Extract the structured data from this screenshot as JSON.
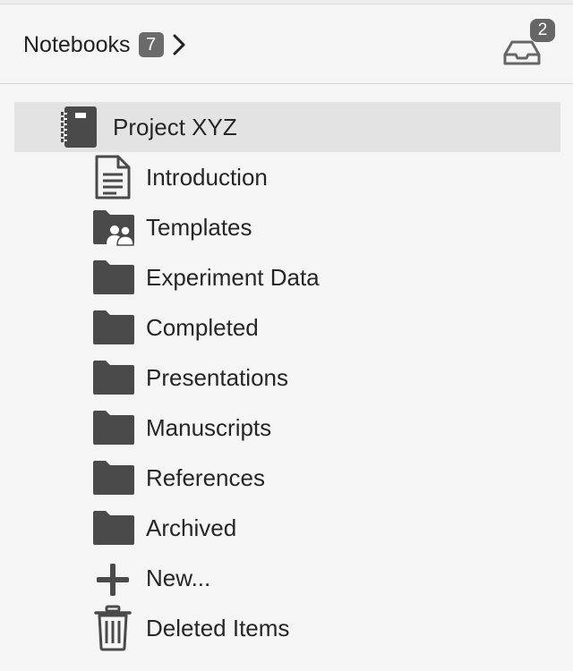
{
  "header": {
    "notebooks_label": "Notebooks",
    "notebooks_count": "7",
    "inbox_count": "2"
  },
  "tree": {
    "notebook": {
      "label": "Project XYZ",
      "icon": "notebook-icon",
      "selected": true
    },
    "items": [
      {
        "label": "Introduction",
        "icon": "document-icon"
      },
      {
        "label": "Templates",
        "icon": "shared-folder-icon"
      },
      {
        "label": "Experiment Data",
        "icon": "folder-icon"
      },
      {
        "label": "Completed",
        "icon": "folder-icon"
      },
      {
        "label": "Presentations",
        "icon": "folder-icon"
      },
      {
        "label": "Manuscripts",
        "icon": "folder-icon"
      },
      {
        "label": "References",
        "icon": "folder-icon"
      },
      {
        "label": "Archived",
        "icon": "folder-icon"
      },
      {
        "label": "New...",
        "icon": "plus-icon"
      },
      {
        "label": "Deleted Items",
        "icon": "trash-icon"
      }
    ]
  },
  "colors": {
    "background": "#f5f5f5",
    "selected_row": "#e3e3e3",
    "icon": "#4a4a4a",
    "badge": "#6b6b6b"
  }
}
